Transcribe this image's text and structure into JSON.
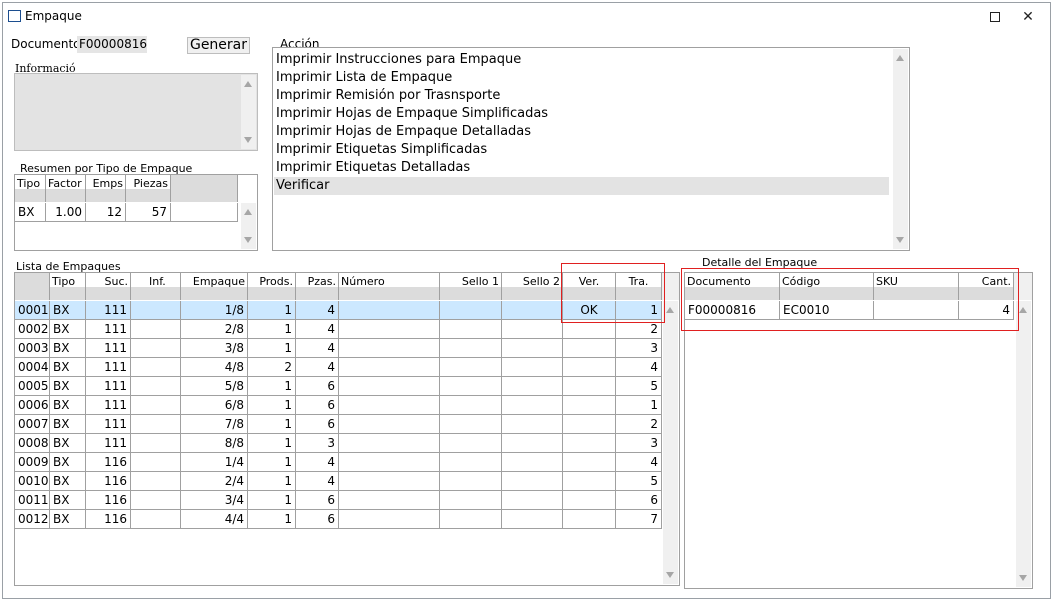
{
  "window": {
    "title": "Empaque"
  },
  "document": {
    "label": "Documento:",
    "value": "F00000816"
  },
  "generate_button": "Generar",
  "info": {
    "label": "Informació"
  },
  "action": {
    "label": "Acción",
    "items": [
      "Imprimir Instrucciones para Empaque",
      "Imprimir Lista de Empaque",
      "Imprimir Remisión por Trasnsporte",
      "Imprimir Hojas de Empaque Simplificadas",
      "Imprimir Hojas de Empaque Detalladas",
      "Imprimir Etiquetas Simplificadas",
      "Imprimir Etiquetas Detalladas",
      "Verificar"
    ]
  },
  "summary": {
    "label": "Resumen por Tipo de Empaque",
    "columns": [
      "Tipo",
      "Factor",
      "Emps",
      "Piezas"
    ],
    "rows": [
      {
        "tipo": "BX",
        "factor": "1.00",
        "emps": "12",
        "piezas": "57"
      }
    ]
  },
  "packages": {
    "label": "Lista de Empaques",
    "columns": [
      "Tipo",
      "Suc.",
      "Inf.",
      "Empaque",
      "Prods.",
      "Pzas.",
      "Número",
      "Sello 1",
      "Sello 2",
      "Ver.",
      "Tra."
    ],
    "rows": [
      {
        "id": "0001",
        "tipo": "BX",
        "suc": "111",
        "inf": "",
        "empaque": "1/8",
        "prods": "1",
        "pzas": "4",
        "numero": "",
        "sello1": "",
        "sello2": "",
        "ver": "OK",
        "tra": "1"
      },
      {
        "id": "0002",
        "tipo": "BX",
        "suc": "111",
        "inf": "",
        "empaque": "2/8",
        "prods": "1",
        "pzas": "4",
        "numero": "",
        "sello1": "",
        "sello2": "",
        "ver": "",
        "tra": "2"
      },
      {
        "id": "0003",
        "tipo": "BX",
        "suc": "111",
        "inf": "",
        "empaque": "3/8",
        "prods": "1",
        "pzas": "4",
        "numero": "",
        "sello1": "",
        "sello2": "",
        "ver": "",
        "tra": "3"
      },
      {
        "id": "0004",
        "tipo": "BX",
        "suc": "111",
        "inf": "",
        "empaque": "4/8",
        "prods": "2",
        "pzas": "4",
        "numero": "",
        "sello1": "",
        "sello2": "",
        "ver": "",
        "tra": "4"
      },
      {
        "id": "0005",
        "tipo": "BX",
        "suc": "111",
        "inf": "",
        "empaque": "5/8",
        "prods": "1",
        "pzas": "6",
        "numero": "",
        "sello1": "",
        "sello2": "",
        "ver": "",
        "tra": "5"
      },
      {
        "id": "0006",
        "tipo": "BX",
        "suc": "111",
        "inf": "",
        "empaque": "6/8",
        "prods": "1",
        "pzas": "6",
        "numero": "",
        "sello1": "",
        "sello2": "",
        "ver": "",
        "tra": "1"
      },
      {
        "id": "0007",
        "tipo": "BX",
        "suc": "111",
        "inf": "",
        "empaque": "7/8",
        "prods": "1",
        "pzas": "6",
        "numero": "",
        "sello1": "",
        "sello2": "",
        "ver": "",
        "tra": "2"
      },
      {
        "id": "0008",
        "tipo": "BX",
        "suc": "111",
        "inf": "",
        "empaque": "8/8",
        "prods": "1",
        "pzas": "3",
        "numero": "",
        "sello1": "",
        "sello2": "",
        "ver": "",
        "tra": "3"
      },
      {
        "id": "0009",
        "tipo": "BX",
        "suc": "116",
        "inf": "",
        "empaque": "1/4",
        "prods": "1",
        "pzas": "4",
        "numero": "",
        "sello1": "",
        "sello2": "",
        "ver": "",
        "tra": "4"
      },
      {
        "id": "0010",
        "tipo": "BX",
        "suc": "116",
        "inf": "",
        "empaque": "2/4",
        "prods": "1",
        "pzas": "4",
        "numero": "",
        "sello1": "",
        "sello2": "",
        "ver": "",
        "tra": "5"
      },
      {
        "id": "0011",
        "tipo": "BX",
        "suc": "116",
        "inf": "",
        "empaque": "3/4",
        "prods": "1",
        "pzas": "6",
        "numero": "",
        "sello1": "",
        "sello2": "",
        "ver": "",
        "tra": "6"
      },
      {
        "id": "0012",
        "tipo": "BX",
        "suc": "116",
        "inf": "",
        "empaque": "4/4",
        "prods": "1",
        "pzas": "6",
        "numero": "",
        "sello1": "",
        "sello2": "",
        "ver": "",
        "tra": "7"
      }
    ]
  },
  "detail": {
    "label": "Detalle del Empaque",
    "columns": [
      "Documento",
      "Código",
      "SKU",
      "Cant."
    ],
    "rows": [
      {
        "documento": "F00000816",
        "codigo": "EC0010",
        "sku": "",
        "cant": "4"
      }
    ]
  },
  "colors": {
    "selected_row": "#cce8ff",
    "highlight_border": "#e02020",
    "selected_action": "#e3e3e3"
  }
}
